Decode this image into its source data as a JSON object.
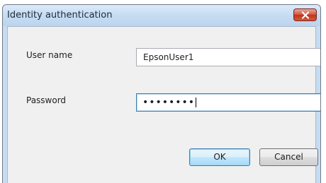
{
  "window": {
    "title": "Identity authentication",
    "close_icon": "close-x-icon"
  },
  "form": {
    "user_name_label": "User name",
    "user_name_value": "EpsonUser1",
    "password_label": "Password",
    "password_masked": "••••••••"
  },
  "buttons": {
    "ok_label": "OK",
    "cancel_label": "Cancel"
  },
  "colors": {
    "title_bar": "#c8ddf3",
    "close_button": "#c0321c",
    "focus_border": "#3c7fb1"
  }
}
